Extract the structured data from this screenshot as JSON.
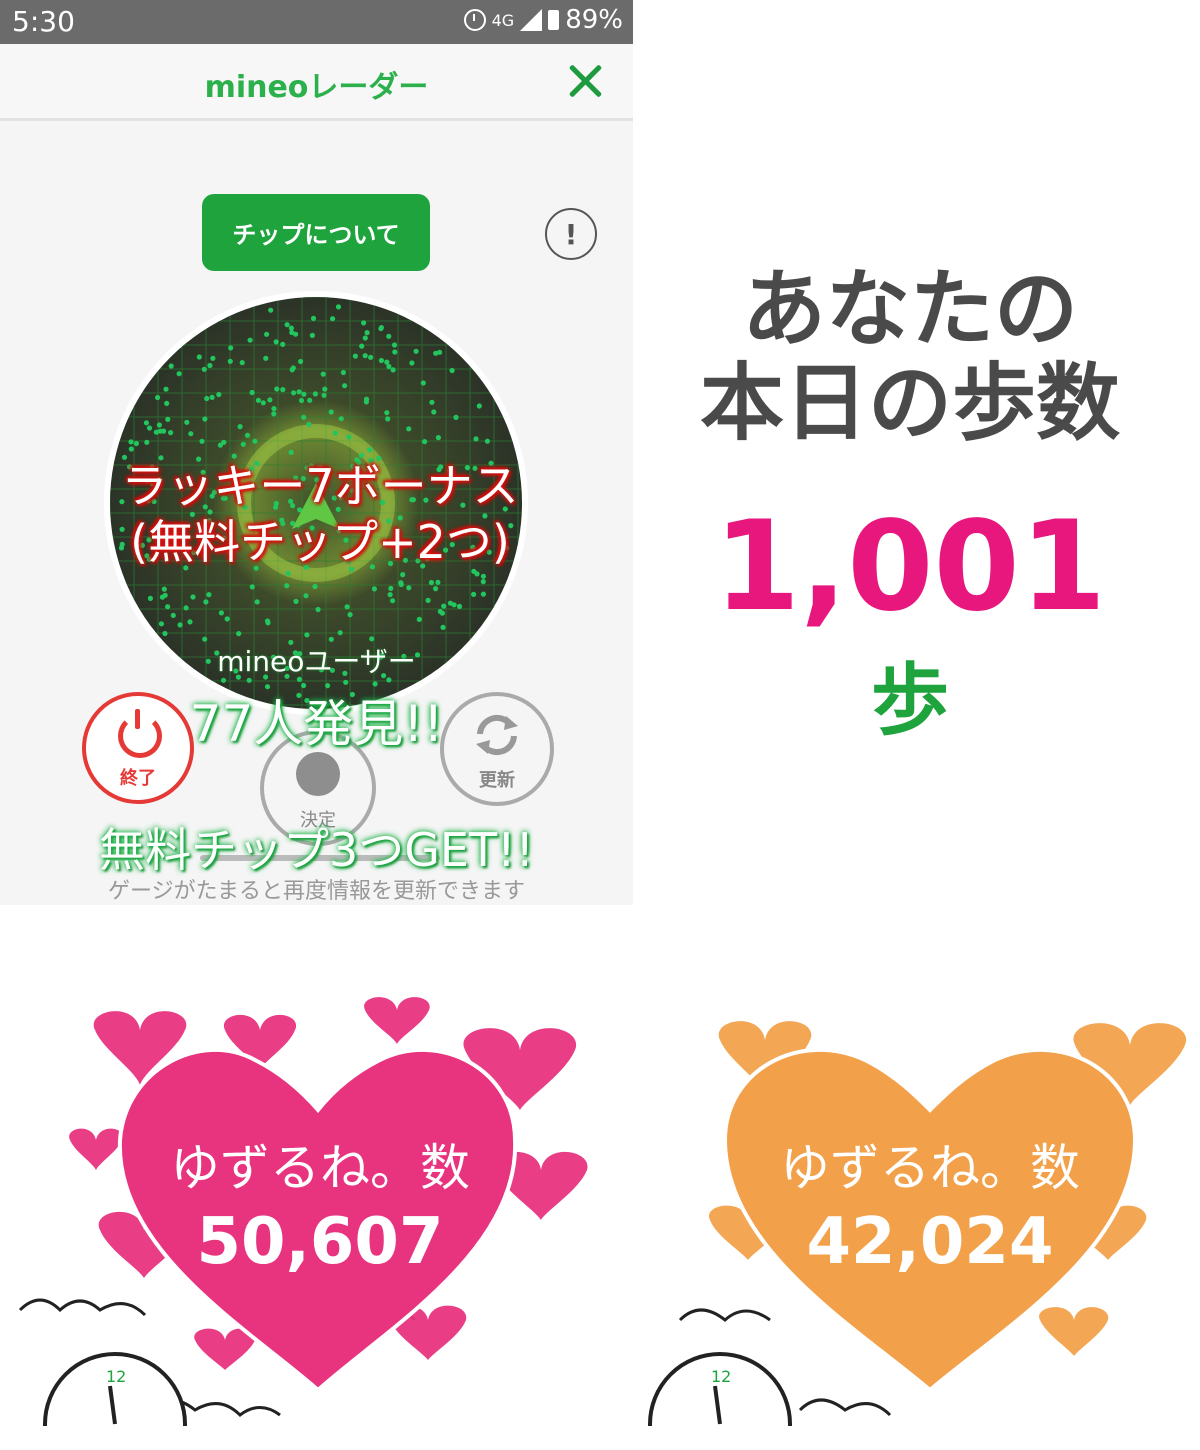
{
  "status_bar": {
    "time": "5:30",
    "network": "4G",
    "battery": "89%"
  },
  "app": {
    "title": "mineoレーダー"
  },
  "chip_button_label": "チップについて",
  "info_icon_glyph": "!",
  "radar": {
    "overlay_line1": "ラッキー7ボーナス",
    "overlay_line2": "(無料チップ+2つ)",
    "user_label": "mineoユーザー",
    "found_count": "77人発見!!"
  },
  "controls": {
    "end_label": "終了",
    "decide_label": "決定",
    "refresh_label": "更新"
  },
  "chip_get": "無料チップ3つGET!!",
  "gauge_note": "ゲージがたまると再度情報を更新できます",
  "steps": {
    "heading_line1": "あなたの",
    "heading_line2": "本日の歩数",
    "value": "1,001",
    "unit": "歩"
  },
  "hearts": [
    {
      "label": "ゆずるね。数",
      "value": "50,607",
      "color": "#e8337f"
    },
    {
      "label": "ゆずるね。数",
      "value": "42,024",
      "color": "#f2a14a"
    }
  ],
  "clock_number": "12",
  "colors": {
    "accent_green": "#1fa33d",
    "header_green": "#2bb04b",
    "step_pink": "#e8177e",
    "end_red": "#e53935"
  }
}
